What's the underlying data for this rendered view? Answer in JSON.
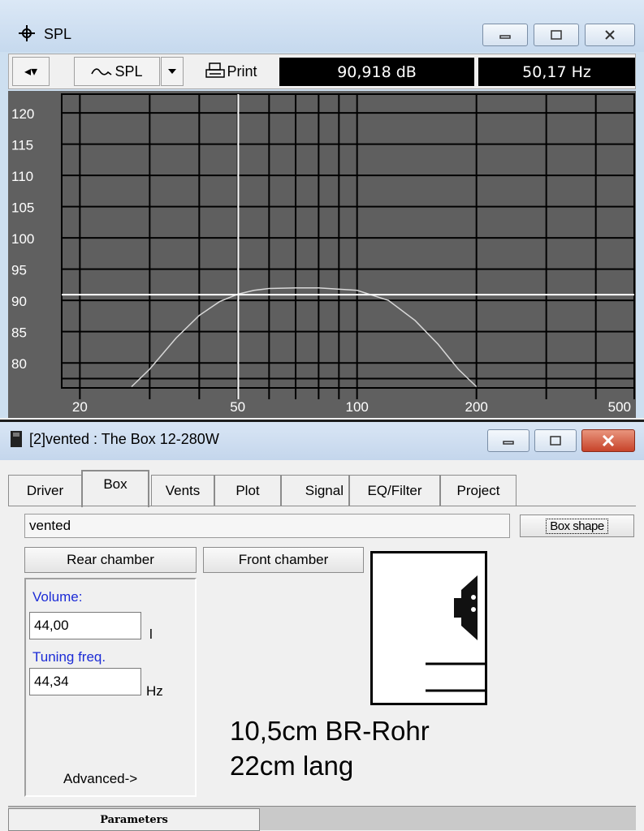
{
  "spl_window": {
    "title": "SPL",
    "toolbar": {
      "nav_glyph": "◂▾",
      "curve_label": "SPL",
      "print_label": "Print",
      "db_readout": "90,918 dB",
      "hz_readout": "50,17 Hz"
    }
  },
  "chart_data": {
    "type": "line",
    "x_scale": "log",
    "xlim": [
      18,
      500
    ],
    "ylim": [
      76,
      123
    ],
    "y_ticks": [
      "120",
      "115",
      "110",
      "105",
      "100",
      "95",
      "90",
      "85",
      "80"
    ],
    "x_ticks": [
      "20",
      "50",
      "100",
      "200",
      "500"
    ],
    "grid": true,
    "cursor": {
      "x": 50.17,
      "y": 90.918
    },
    "series": [
      {
        "x": [
          27,
          30,
          35,
          40,
          45,
          50,
          55,
          60,
          70,
          80,
          100,
          120,
          140,
          160,
          180,
          200
        ],
        "y": [
          76.2,
          79,
          84,
          87.6,
          89.8,
          91.0,
          91.6,
          91.9,
          92.0,
          92.0,
          91.6,
          90.0,
          86.8,
          83.0,
          79.0,
          76.2
        ]
      }
    ]
  },
  "box_window": {
    "title": "[2]vented : The Box 12-280W",
    "tabs": [
      "Driver",
      "Box",
      "Vents",
      "Plot",
      "Signal",
      "EQ/Filter",
      "Project"
    ],
    "active_tab": "Box",
    "box_type_value": "vented",
    "box_shape_label": "Box shape",
    "rear_chamber_label": "Rear chamber",
    "front_chamber_label": "Front chamber",
    "volume_label": "Volume:",
    "volume_value": "44,00",
    "volume_unit": "l",
    "tuning_label": "Tuning freq.",
    "tuning_value": "44,34",
    "tuning_unit": "Hz",
    "advanced_label": "Advanced->",
    "note_line1": "10,5cm BR-Rohr",
    "note_line2": "22cm lang",
    "status_tab": "Parameters"
  }
}
